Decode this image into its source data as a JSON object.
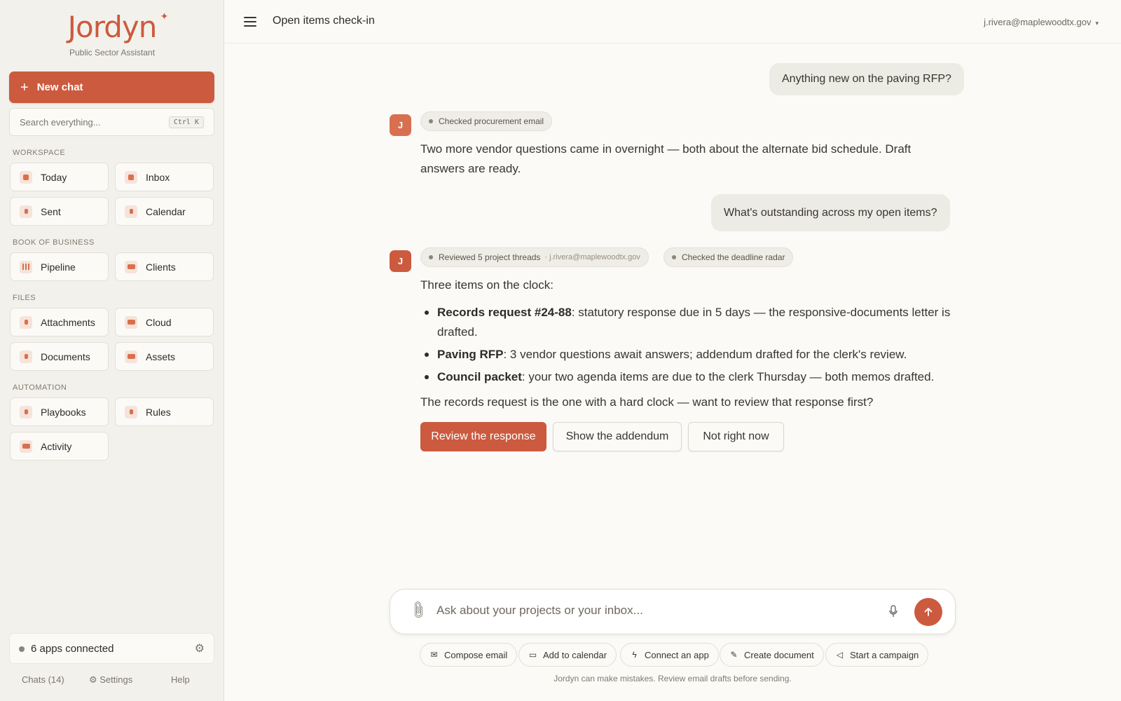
{
  "brand": {
    "name": "Jordyn",
    "subtitle": "Public Sector Assistant",
    "accent": "#cc5a3e"
  },
  "sidebar": {
    "new_chat": "New chat",
    "search": {
      "placeholder": "Search everything...",
      "shortcut": "Ctrl K"
    },
    "sections": [
      {
        "label": "WORKSPACE",
        "items": [
          {
            "label": "Today",
            "icon": "sun-icon"
          },
          {
            "label": "Inbox",
            "icon": "inbox-icon"
          },
          {
            "label": "Sent",
            "icon": "send-icon"
          },
          {
            "label": "Calendar",
            "icon": "calendar-icon"
          }
        ]
      },
      {
        "label": "BOOK OF BUSINESS",
        "items": [
          {
            "label": "Pipeline",
            "icon": "pipeline-icon"
          },
          {
            "label": "Clients",
            "icon": "clients-icon"
          }
        ]
      },
      {
        "label": "FILES",
        "items": [
          {
            "label": "Attachments",
            "icon": "paperclip-icon"
          },
          {
            "label": "Cloud",
            "icon": "cloud-icon"
          },
          {
            "label": "Documents",
            "icon": "document-icon"
          },
          {
            "label": "Assets",
            "icon": "image-icon"
          }
        ]
      },
      {
        "label": "AUTOMATION",
        "items": [
          {
            "label": "Playbooks",
            "icon": "playbook-icon"
          },
          {
            "label": "Rules",
            "icon": "rules-icon"
          },
          {
            "label": "Activity",
            "icon": "activity-icon"
          }
        ]
      }
    ],
    "apps_connected": "6 apps connected",
    "footer": {
      "chats": "Chats (14)",
      "settings": "Settings",
      "help": "Help"
    }
  },
  "header": {
    "title": "Open items check-in",
    "user": "j.rivera@maplewoodtx.gov"
  },
  "chat": {
    "avatar_letter": "J",
    "user_msg_1": "Anything new on the paving RFP?",
    "chip_1": "Checked procurement email",
    "reply_1": "Two more vendor questions came in overnight — both about the alternate bid schedule. Draft answers are ready.",
    "user_msg_2": "What's outstanding across my open items?",
    "chip_2": {
      "label": "Reviewed 5 project threads",
      "sub": "· j.rivera@maplewoodtx.gov"
    },
    "chip_3": "Checked the deadline radar",
    "intro": "Three items on the clock:",
    "items": [
      {
        "bold": "Records request #24-88",
        "text": ": statutory response due in 5 days — the responsive-documents letter is drafted."
      },
      {
        "bold": "Paving RFP",
        "text": ": 3 vendor questions await answers; addendum drafted for the clerk's review."
      },
      {
        "bold": "Council packet",
        "text": ": your two agenda items are due to the clerk Thursday — both memos drafted."
      }
    ],
    "closing": "The records request is the one with a hard clock — want to review that response first?",
    "actions": {
      "primary": "Review the response",
      "secondary": "Show the addendum",
      "tertiary": "Not right now"
    }
  },
  "composer": {
    "placeholder": "Ask about your projects or your inbox...",
    "quick_actions": [
      "Compose email",
      "Add to calendar",
      "Connect an app",
      "Create document",
      "Start a campaign"
    ],
    "disclaimer": "Jordyn can make mistakes. Review email drafts before sending."
  }
}
